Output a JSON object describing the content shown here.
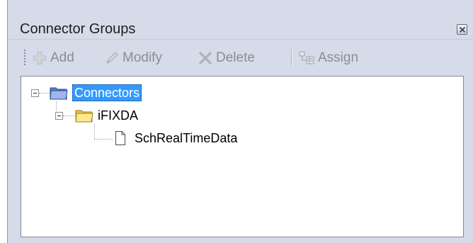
{
  "window": {
    "title": "Connector Groups"
  },
  "toolbar": {
    "add_label": "Add",
    "modify_label": "Modify",
    "delete_label": "Delete",
    "assign_label": "Assign"
  },
  "tree": {
    "root": {
      "label": "Connectors",
      "selected": true,
      "icon": "folder-blue-icon",
      "children": [
        {
          "label": "iFIXDA",
          "icon": "folder-yellow-icon",
          "children": [
            {
              "label": "SchRealTimeData",
              "icon": "document-icon"
            }
          ]
        }
      ]
    }
  },
  "colors": {
    "panel_bg": "#d6dbe9",
    "selection": "#3399ff",
    "disabled_text": "#8a8d94"
  }
}
